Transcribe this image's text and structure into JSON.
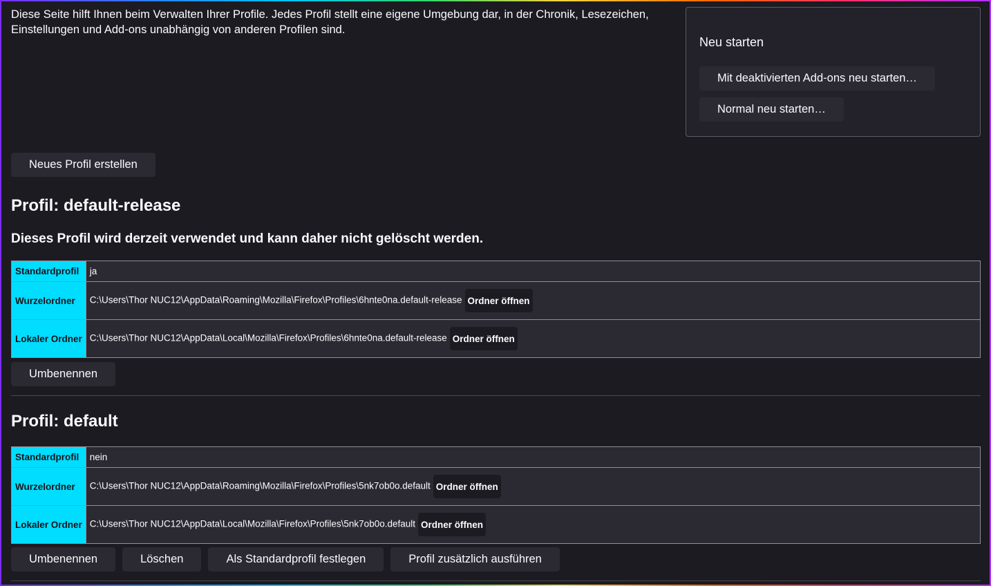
{
  "intro": "Diese Seite hilft Ihnen beim Verwalten Ihrer Profile. Jedes Profil stellt eine eigene Umgebung dar, in der Chronik, Lesezeichen, Einstellungen und Add-ons unabhängig von anderen Profilen sind.",
  "restart": {
    "title": "Neu starten",
    "safe_mode_label": "Mit deaktivierten Add-ons neu starten…",
    "normal_label": "Normal neu starten…"
  },
  "create_profile_label": "Neues Profil erstellen",
  "profiles": [
    {
      "title": "Profil: default-release",
      "note": "Dieses Profil wird derzeit verwendet und kann daher nicht gelöscht werden.",
      "rows": {
        "default_key": "Standardprofil",
        "default_value": "ja",
        "root_key": "Wurzelordner",
        "root_value": "C:\\Users\\Thor NUC12\\AppData\\Roaming\\Mozilla\\Firefox\\Profiles\\6hnte0na.default-release",
        "local_key": "Lokaler Ordner",
        "local_value": "C:\\Users\\Thor NUC12\\AppData\\Local\\Mozilla\\Firefox\\Profiles\\6hnte0na.default-release",
        "open_folder_label": "Ordner öffnen"
      },
      "actions": {
        "rename": "Umbenennen"
      }
    },
    {
      "title": "Profil: default",
      "rows": {
        "default_key": "Standardprofil",
        "default_value": "nein",
        "root_key": "Wurzelordner",
        "root_value": "C:\\Users\\Thor NUC12\\AppData\\Roaming\\Mozilla\\Firefox\\Profiles\\5nk7ob0o.default",
        "local_key": "Lokaler Ordner",
        "local_value": "C:\\Users\\Thor NUC12\\AppData\\Local\\Mozilla\\Firefox\\Profiles\\5nk7ob0o.default",
        "open_folder_label": "Ordner öffnen"
      },
      "actions": {
        "rename": "Umbenennen",
        "delete": "Löschen",
        "set_default": "Als Standardprofil festlegen",
        "launch": "Profil zusätzlich ausführen"
      }
    }
  ]
}
